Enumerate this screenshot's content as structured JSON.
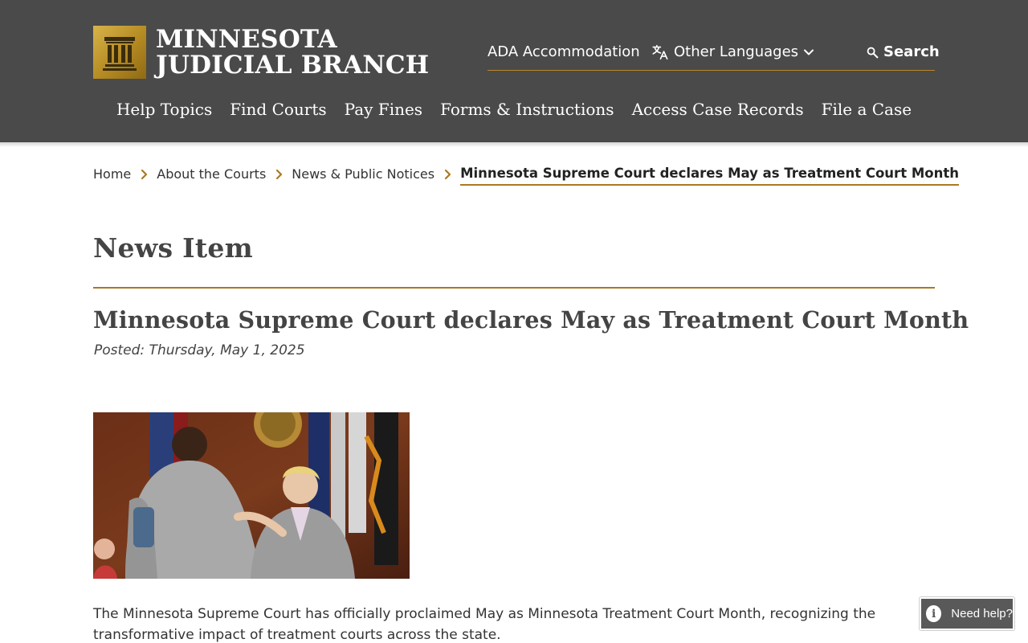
{
  "header": {
    "logo_line1": "MINNESOTA",
    "logo_line2": "JUDICIAL BRANCH",
    "utility": {
      "ada": "ADA Accommodation",
      "languages": "Other Languages",
      "search": "Search"
    },
    "nav": [
      "Help Topics",
      "Find Courts",
      "Pay Fines",
      "Forms & Instructions",
      "Access Case Records",
      "File a Case"
    ]
  },
  "breadcrumb": [
    "Home",
    "About the Courts",
    "News & Public Notices",
    "Minnesota Supreme Court declares May as Treatment Court Month"
  ],
  "content": {
    "section_title": "News Item",
    "article_title": "Minnesota Supreme Court declares May as Treatment Court Month",
    "posted": "Posted: Thursday, May 1, 2025",
    "image_alt": "Photo",
    "body_line1": "The Minnesota Supreme Court has officially proclaimed May as Minnesota Treatment Court Month, recognizing the",
    "body_line2": "transformative impact of treatment courts across the state."
  },
  "help_widget": {
    "label": "Need help?",
    "icon": "i"
  },
  "colors": {
    "header_bg": "#4a4a4a",
    "accent_gold": "#a97a22",
    "text": "#333333"
  }
}
